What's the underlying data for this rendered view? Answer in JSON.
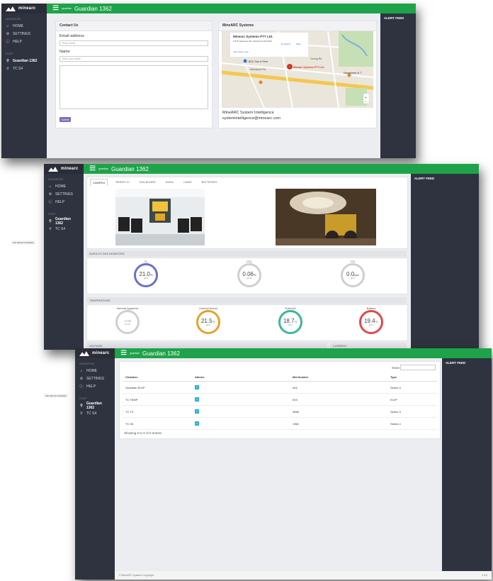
{
  "brand": {
    "name": "minearc",
    "sub": "SYSTEMS"
  },
  "sidebar": {
    "section_nav": "NAVIGATION",
    "items": [
      {
        "label": "HOME",
        "icon": "home-icon"
      },
      {
        "label": "SETTINGS",
        "icon": "gear-icon"
      },
      {
        "label": "HELP",
        "icon": "help-icon"
      }
    ],
    "section_fleet": "FLEET",
    "fleet": [
      {
        "label": "Guardian 1362",
        "icon": "link-icon"
      },
      {
        "label": "TC S4",
        "icon": "link-icon"
      }
    ]
  },
  "topbar": {
    "small": "guardian",
    "title": "Guardian 1362"
  },
  "alert_feed": "ALERT FEED",
  "contact": {
    "header": "Contact Us",
    "email_label": "Email address",
    "email_placeholder": "Enter email",
    "name_label": "Name",
    "name_placeholder": "Enter your name",
    "submit": "Submit"
  },
  "systems": {
    "header": "MineARC Systems",
    "map_card_title": "Minearc Systems PTY Ltd.",
    "map_card_addr": "1/275 Hectlower Rd, Welshpool WA 6106",
    "map_directions": "Directions",
    "map_save": "Save",
    "map_larger": "View larger map",
    "map_marker": "Minearc Systems PTY Ltd.",
    "map_places": [
      "BOC Gas & Gear",
      "Orrong Rd",
      "Welshpool Rd",
      "Department of T"
    ],
    "line1": "MineARC System Intelligence",
    "line2": "systemintelligence@minearc.com"
  },
  "camera": {
    "tabs": [
      "CAMERA",
      "SERIES IV",
      "FAN BOARD",
      "AURA",
      "CAMS",
      "BATTERIES"
    ],
    "gas_header": "AURA-FX GAS MONITORS",
    "gas": [
      {
        "label": "O₂",
        "value": "21.0",
        "unit": "%",
        "sub": "@0.0",
        "color": "#6a6fd0",
        "level": 0.7
      },
      {
        "label": "CO₂",
        "value": "0.06",
        "unit": "%",
        "sub": "@0.08",
        "color": "#cfcfcf",
        "level": 0.05
      },
      {
        "label": "CO",
        "value": "0.0",
        "unit": "ppm",
        "sub": "@0.0",
        "color": "#cfcfcf",
        "level": 0.02
      }
    ],
    "temp_header": "TEMPERATURE",
    "temps": [
      {
        "label": "Internal Apparent",
        "value": "---",
        "unit": "°C",
        "sub": "16 °C/h",
        "color": "#cfcfcf",
        "level": 0
      },
      {
        "label": "Internal Actual",
        "value": "21.5",
        "unit": "°C",
        "sub": "@0.0",
        "color": "#e8a12a",
        "level": 0.55
      },
      {
        "label": "External",
        "value": "18.7",
        "unit": "°C",
        "sub": "@0.0",
        "color": "#3fb59a",
        "level": 0.5
      },
      {
        "label": "Battery",
        "value": "19.4",
        "unit": "°C",
        "sub": "@0.0",
        "color": "#e04a4a",
        "level": 0.5
      }
    ],
    "voltage": "VOLTAGE",
    "current": "CURRENT"
  },
  "table": {
    "search_label": "Search:",
    "columns": [
      "Chamber",
      "Alarms",
      "MA Number",
      "Type"
    ],
    "rows": [
      {
        "chamber": "Guardian ELVP",
        "alarms": "0",
        "ma": "004",
        "type": "Series 4"
      },
      {
        "chamber": "TC TEMP",
        "alarms": "0",
        "ma": "003",
        "type": "ELVP"
      },
      {
        "chamber": "TC T3",
        "alarms": "0",
        "ma": "3556",
        "type": "Series 3"
      },
      {
        "chamber": "TC S4",
        "alarms": "0",
        "ma": "1362",
        "type": "Series 4"
      }
    ],
    "info": "Showing 0 to 0 of 0 entries",
    "footer": "© MineARC Systems Copyright",
    "version": "2.0.6"
  },
  "ip_label": "192.168.10.176/dashb"
}
